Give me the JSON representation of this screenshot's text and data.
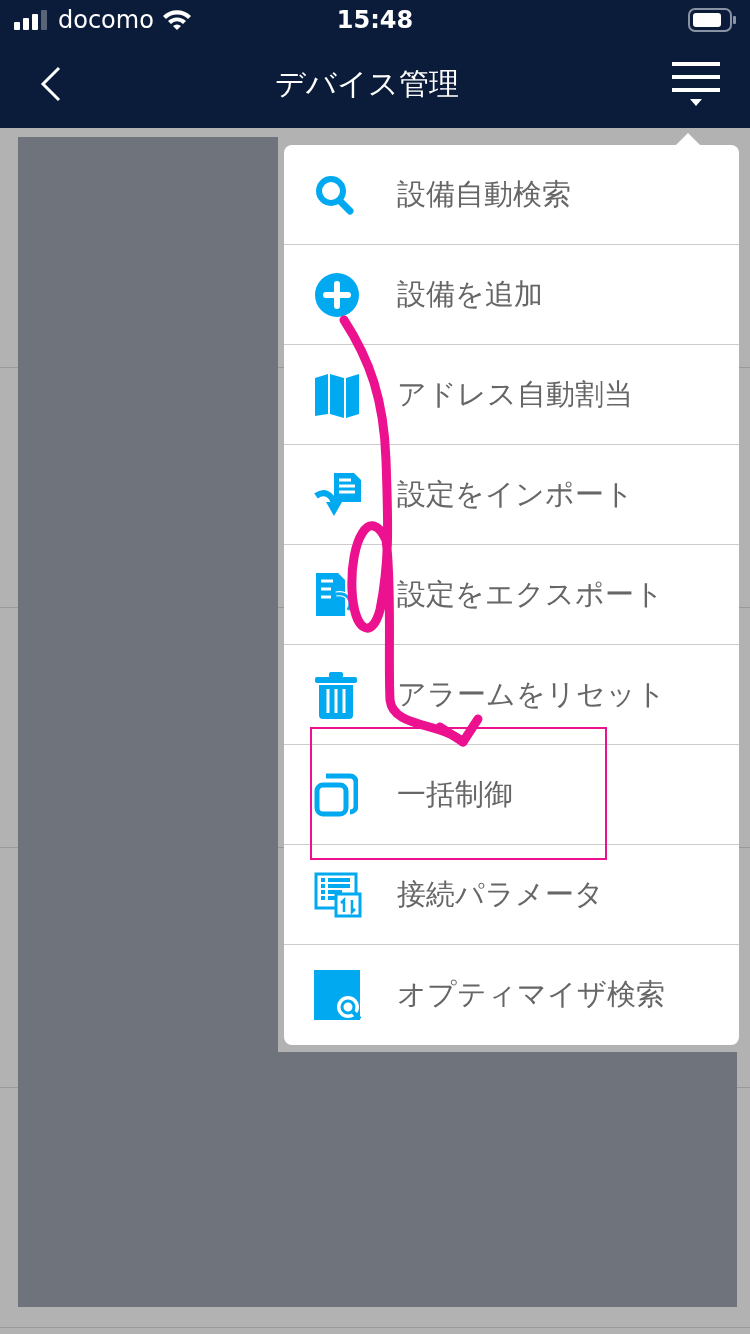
{
  "status_bar": {
    "carrier": "docomo",
    "time": "15:48"
  },
  "nav_bar": {
    "title": "デバイス管理"
  },
  "menu": {
    "items": [
      {
        "label": "設備自動検索",
        "kind": "search",
        "highlighted": false
      },
      {
        "label": "設備を追加",
        "kind": "add",
        "highlighted": false
      },
      {
        "label": "アドレス自動割当",
        "kind": "map",
        "highlighted": false
      },
      {
        "label": "設定をインポート",
        "kind": "import",
        "highlighted": false
      },
      {
        "label": "設定をエクスポート",
        "kind": "export",
        "highlighted": false
      },
      {
        "label": "アラームをリセット",
        "kind": "trash",
        "highlighted": false
      },
      {
        "label": "一括制御",
        "kind": "batch",
        "highlighted": true
      },
      {
        "label": "接続パラメータ",
        "kind": "params",
        "highlighted": false
      },
      {
        "label": "オプティマイザ検索",
        "kind": "optimizer",
        "highlighted": false
      }
    ]
  }
}
